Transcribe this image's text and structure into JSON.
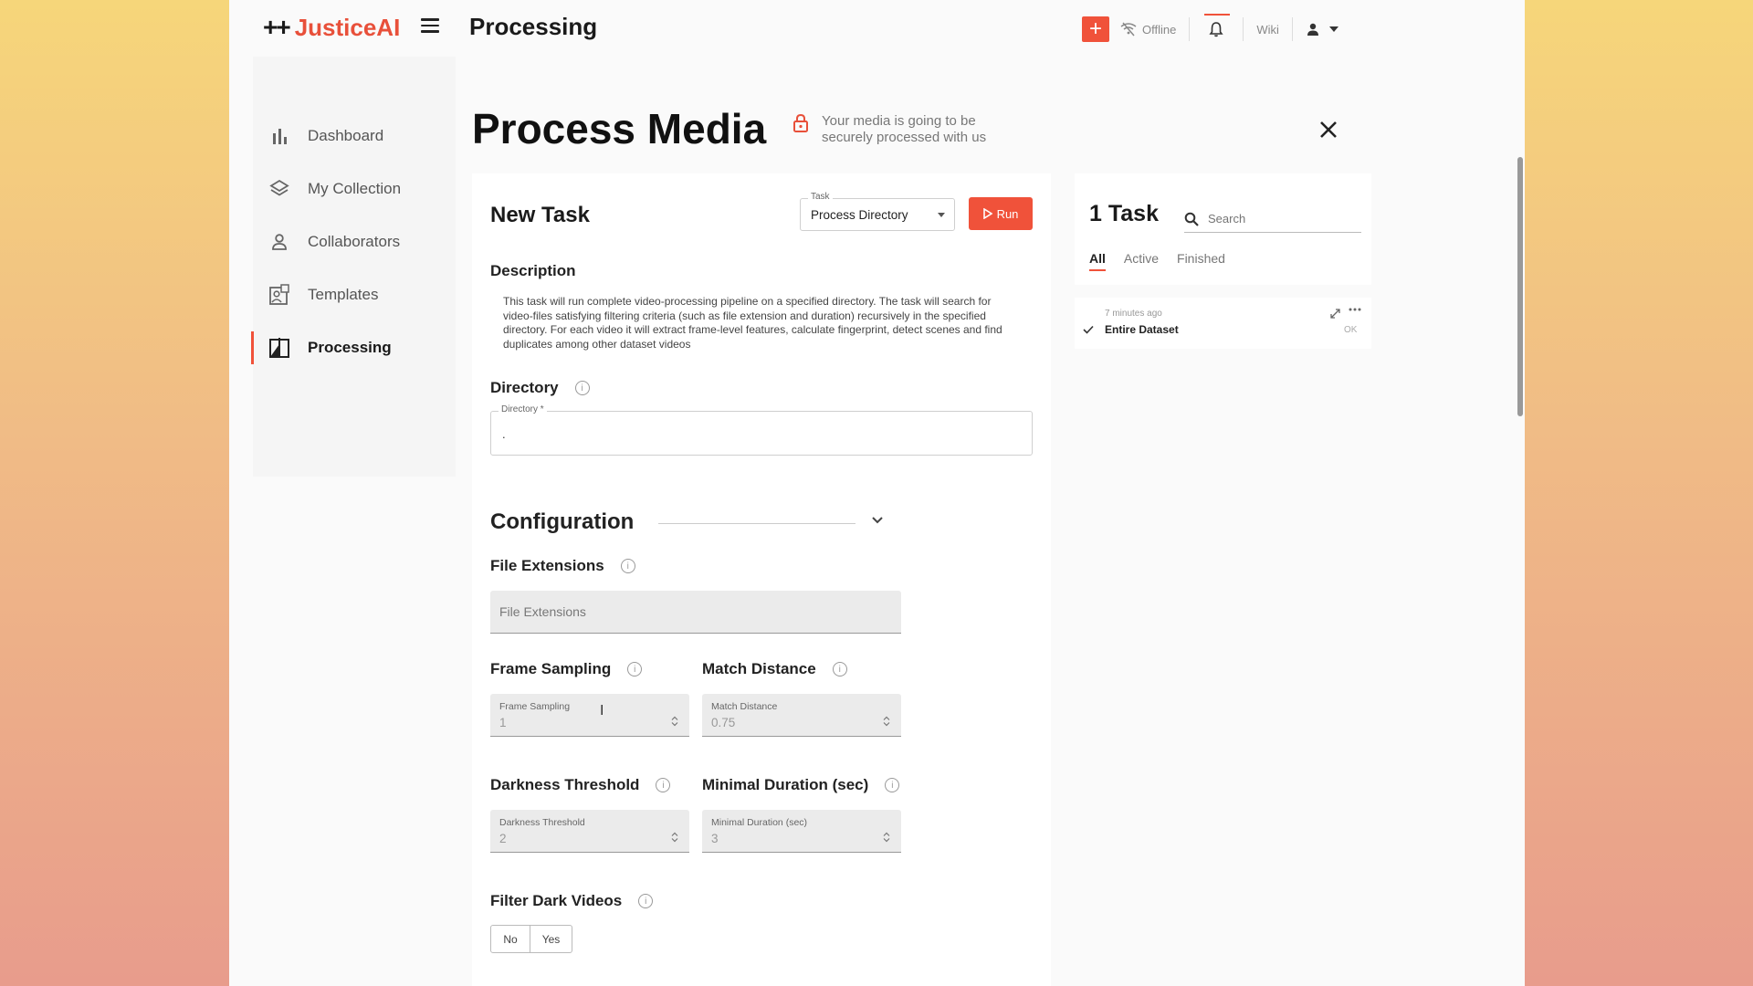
{
  "topbar": {
    "logo_plus": "++",
    "logo_brand": "JusticeAI",
    "page_title": "Processing",
    "add_label": "+",
    "offline_label": "Offline",
    "wiki_label": "Wiki"
  },
  "sidebar": {
    "items": [
      {
        "label": "Dashboard",
        "icon": "bar-chart-icon"
      },
      {
        "label": "My Collection",
        "icon": "layers-icon"
      },
      {
        "label": "Collaborators",
        "icon": "person-icon"
      },
      {
        "label": "Templates",
        "icon": "template-icon"
      },
      {
        "label": "Processing",
        "icon": "processing-icon",
        "active": true
      }
    ]
  },
  "header": {
    "title": "Process Media",
    "secure_text": "Your media is going to be securely processed with us"
  },
  "form": {
    "heading": "New Task",
    "task_select_label": "Task",
    "task_select_value": "Process Directory",
    "run_label": "Run",
    "description_label": "Description",
    "description_text": "This task will run complete video-processing pipeline on a specified directory. The task will search for video-files satisfying filtering criteria (such as file extension and duration) recursively in the specified directory. For each video it will extract frame-level features, calculate fingerprint, detect scenes and find duplicates among other dataset videos",
    "directory_label": "Directory",
    "directory_field_label": "Directory *",
    "directory_value": ".",
    "configuration_label": "Configuration",
    "file_extensions_label": "File Extensions",
    "file_extensions_placeholder": "File Extensions",
    "frame_sampling_label": "Frame Sampling",
    "frame_sampling_field_label": "Frame Sampling",
    "frame_sampling_value": "1",
    "match_distance_label": "Match Distance",
    "match_distance_field_label": "Match Distance",
    "match_distance_value": "0.75",
    "darkness_threshold_label": "Darkness Threshold",
    "darkness_threshold_field_label": "Darkness Threshold",
    "darkness_threshold_value": "2",
    "minimal_duration_label": "Minimal Duration (sec)",
    "minimal_duration_field_label": "Minimal Duration (sec)",
    "minimal_duration_value": "3",
    "filter_dark_label": "Filter Dark Videos",
    "filter_no": "No",
    "filter_yes": "Yes"
  },
  "tasks": {
    "count_label": "1 Task",
    "search_placeholder": "Search",
    "tabs": [
      {
        "label": "All",
        "active": true
      },
      {
        "label": "Active"
      },
      {
        "label": "Finished"
      }
    ],
    "items": [
      {
        "time": "7 minutes ago",
        "name": "Entire Dataset",
        "status": "OK"
      }
    ]
  },
  "colors": {
    "accent": "#f0523a",
    "brand": "#e8503a"
  }
}
